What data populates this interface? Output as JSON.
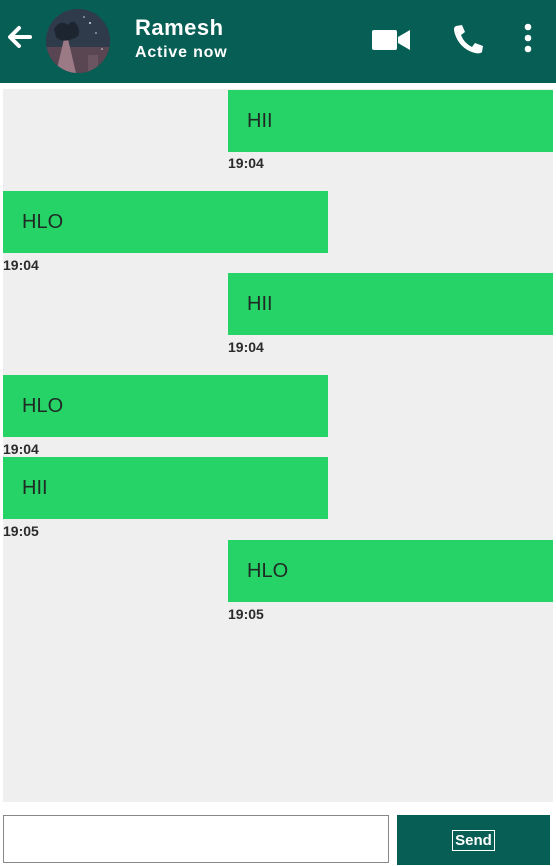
{
  "header": {
    "contact_name": "Ramesh",
    "status": "Active now",
    "background": "#075e54"
  },
  "messages": [
    {
      "direction": "out",
      "text": "HII",
      "time": "19:04"
    },
    {
      "direction": "in",
      "text": "HLO",
      "time": "19:04"
    },
    {
      "direction": "out",
      "text": "HII",
      "time": "19:04"
    },
    {
      "direction": "in",
      "text": "HLO",
      "time": "19:04"
    },
    {
      "direction": "in",
      "text": "HII",
      "time": "19:05"
    },
    {
      "direction": "out",
      "text": "HLO",
      "time": "19:05"
    }
  ],
  "composer": {
    "input_value": "",
    "placeholder": "",
    "send_label": "Send"
  },
  "colors": {
    "accent": "#075e54",
    "bubble": "#25d366",
    "chat_bg": "#efefef"
  }
}
